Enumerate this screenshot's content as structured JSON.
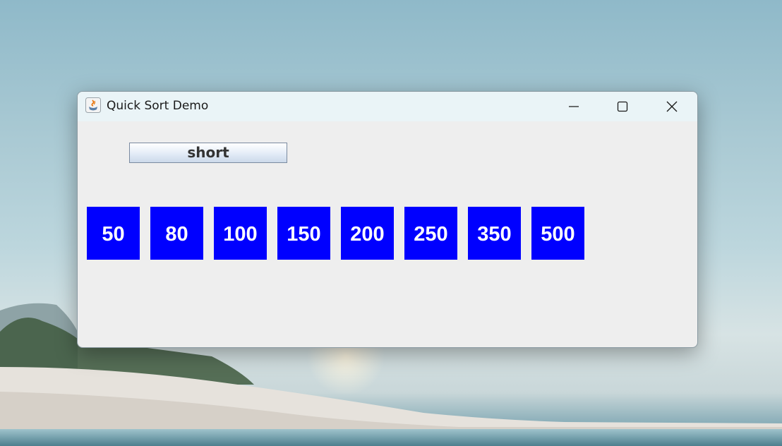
{
  "window": {
    "title": "Quick Sort Demo",
    "app_icon": "java-icon",
    "controls": {
      "minimize_icon": "minimize-icon",
      "maximize_icon": "maximize-icon",
      "close_icon": "close-icon"
    }
  },
  "content": {
    "sort_button_label": "short",
    "values": [
      "50",
      "80",
      "100",
      "150",
      "200",
      "250",
      "350",
      "500"
    ]
  },
  "colors": {
    "box": "#0000ff",
    "box_text": "#ffffff",
    "content_bg": "#eeeeee",
    "titlebar_bg": "#eaf4f7"
  }
}
